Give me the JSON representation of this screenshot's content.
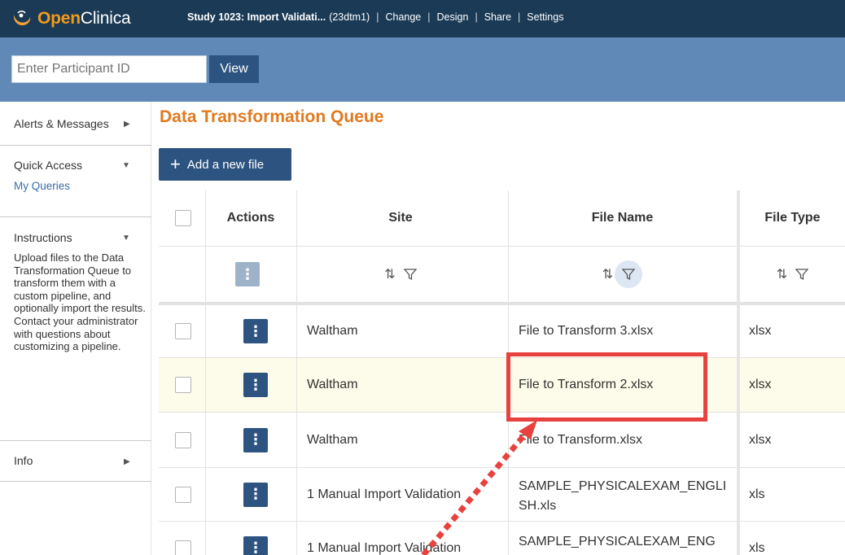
{
  "topbar": {
    "logo_open": "Open",
    "logo_clinica": "Clinica",
    "study_name": "Study 1023: Import Validati...",
    "study_code": "(23dtm1)",
    "separator": "|",
    "links": [
      "Change",
      "Design",
      "Share",
      "Settings"
    ]
  },
  "participant": {
    "placeholder": "Enter Participant ID",
    "view_label": "View"
  },
  "sidebar": {
    "alerts": "Alerts & Messages",
    "quick_access": "Quick Access",
    "my_queries": "My Queries",
    "instructions": "Instructions",
    "instructions_text": "Upload files to the Data Transformation Queue to transform them with a custom pipeline, and optionally import the results. Contact your administrator with questions about customizing a pipeline.",
    "info": "Info"
  },
  "main": {
    "title": "Data Transformation Queue",
    "add_button": "Add a new file",
    "columns": [
      "Actions",
      "Site",
      "File Name",
      "File Type"
    ],
    "action_glyph": "⋮",
    "sort_glyph": "⇅",
    "rows": [
      {
        "site": "Waltham",
        "file_name": "File to Transform 3.xlsx",
        "file_type": "xlsx"
      },
      {
        "site": "Waltham",
        "file_name": "File to Transform 2.xlsx",
        "file_type": "xlsx"
      },
      {
        "site": "Waltham",
        "file_name": "File to Transform.xlsx",
        "file_type": "xlsx"
      },
      {
        "site": "1 Manual Import Validation",
        "file_name": "SAMPLE_PHYSICALEXAM_ENGLISH.xls",
        "file_type": "xls"
      },
      {
        "site": "1 Manual Import Validation",
        "file_name": "SAMPLE_PHYSICALEXAM_ENG",
        "file_type": "xls"
      }
    ]
  },
  "colors": {
    "topbar": "#1a3a55",
    "band": "#6089b8",
    "primary_button": "#2d5480",
    "title_orange": "#e07a1f",
    "highlight_row": "#fdfbe9",
    "annotation_red": "#e8423e"
  },
  "icons": [
    "openclinica-logo-icon",
    "plus-icon",
    "kebab-menu-icon",
    "sort-icon",
    "filter-icon",
    "caret-right-icon",
    "caret-down-icon"
  ]
}
